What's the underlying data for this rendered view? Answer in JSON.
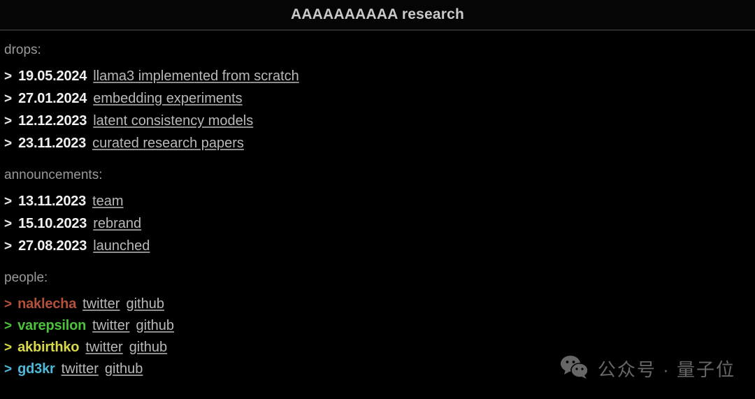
{
  "header": {
    "title": "AAAAAAAAAA research"
  },
  "colors": {
    "background": "#000000",
    "header_background": "#050505",
    "divider": "#2b2b2b",
    "section_label": "#9a9a9a",
    "date": "#f2f2f2",
    "link": "#b9b9b9",
    "caret": "#e9e9e9",
    "watermark": "#8f8f8f"
  },
  "sections": {
    "drops": {
      "label": "drops:",
      "items": [
        {
          "caret": ">",
          "date": "19.05.2024",
          "link": "llama3 implemented from scratch"
        },
        {
          "caret": ">",
          "date": "27.01.2024",
          "link": "embedding experiments"
        },
        {
          "caret": ">",
          "date": "12.12.2023",
          "link": "latent consistency models"
        },
        {
          "caret": ">",
          "date": "23.11.2023",
          "link": "curated research papers"
        }
      ]
    },
    "announcements": {
      "label": "announcements:",
      "items": [
        {
          "caret": ">",
          "date": "13.11.2023",
          "link": "team"
        },
        {
          "caret": ">",
          "date": "15.10.2023",
          "link": "rebrand"
        },
        {
          "caret": ">",
          "date": "27.08.2023",
          "link": "launched"
        }
      ]
    },
    "people": {
      "label": "people:",
      "items": [
        {
          "caret": ">",
          "name": "naklecha",
          "color": "#b5503a",
          "twitter": "twitter",
          "github": "github"
        },
        {
          "caret": ">",
          "name": "varepsilon",
          "color": "#4cc23a",
          "twitter": "twitter",
          "github": "github"
        },
        {
          "caret": ">",
          "name": "akbirthko",
          "color": "#d8d94a",
          "twitter": "twitter",
          "github": "github"
        },
        {
          "caret": ">",
          "name": "gd3kr",
          "color": "#4fb8d8",
          "twitter": "twitter",
          "github": "github"
        }
      ]
    }
  },
  "watermark": {
    "icon": "wechat-icon",
    "text": "公众号 · 量子位"
  }
}
